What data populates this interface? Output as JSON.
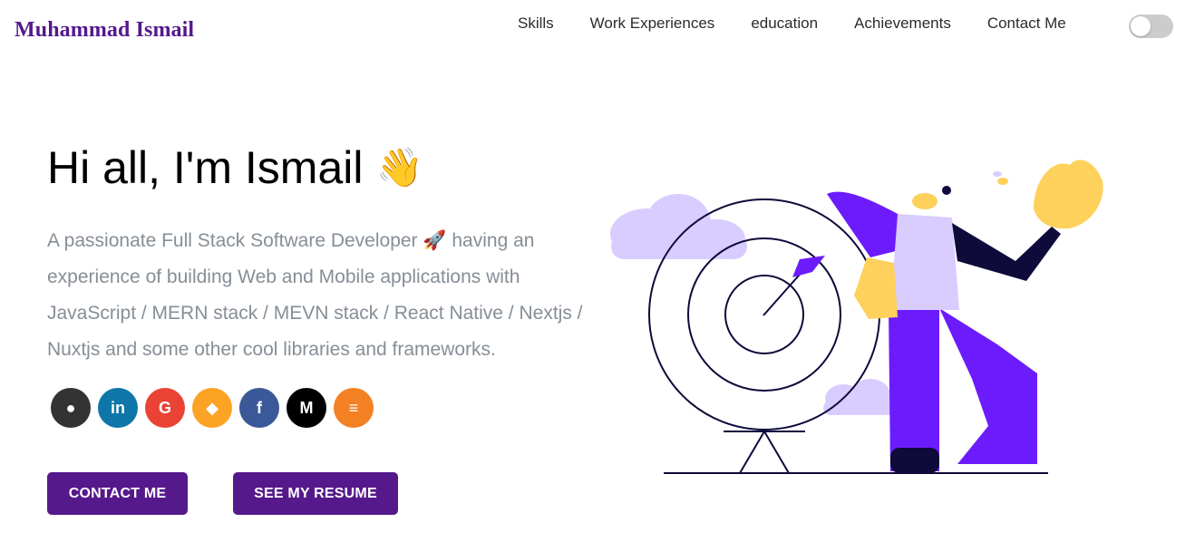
{
  "header": {
    "logo": "Muhammad Ismail",
    "nav": [
      {
        "label": "Skills"
      },
      {
        "label": "Work Experiences"
      },
      {
        "label": "education"
      },
      {
        "label": "Achievements"
      },
      {
        "label": "Contact Me"
      }
    ],
    "dark_mode_toggle": {
      "on": false
    }
  },
  "hero": {
    "greeting": "Hi all, I'm Ismail",
    "greeting_emoji": "👋",
    "subtitle": "A passionate Full Stack Software Developer 🚀 having an experience of building Web and Mobile applications with JavaScript / MERN stack / MEVN stack / React Native / Nextjs / Nuxtjs and some other cool libraries and frameworks.",
    "socials": [
      {
        "icon": "github-icon",
        "glyph": "●",
        "color": "#333333"
      },
      {
        "icon": "linkedin-icon",
        "glyph": "in",
        "color": "#0e76a8"
      },
      {
        "icon": "google-icon",
        "glyph": "G",
        "color": "#ea4335"
      },
      {
        "icon": "gitlab-icon",
        "glyph": "◆",
        "color": "#fca326"
      },
      {
        "icon": "facebook-icon",
        "glyph": "f",
        "color": "#3b5998"
      },
      {
        "icon": "medium-icon",
        "glyph": "M",
        "color": "#000000"
      },
      {
        "icon": "stackoverflow-icon",
        "glyph": "≡",
        "color": "#f48024"
      }
    ],
    "contact_button": "CONTACT ME",
    "resume_button": "SEE MY RESUME"
  },
  "colors": {
    "accent": "#55198b",
    "subtitle": "#868e96",
    "illustration_purple": "#6c1cfc",
    "illustration_lavender": "#d9ccff",
    "skin": "#fdd15b"
  }
}
